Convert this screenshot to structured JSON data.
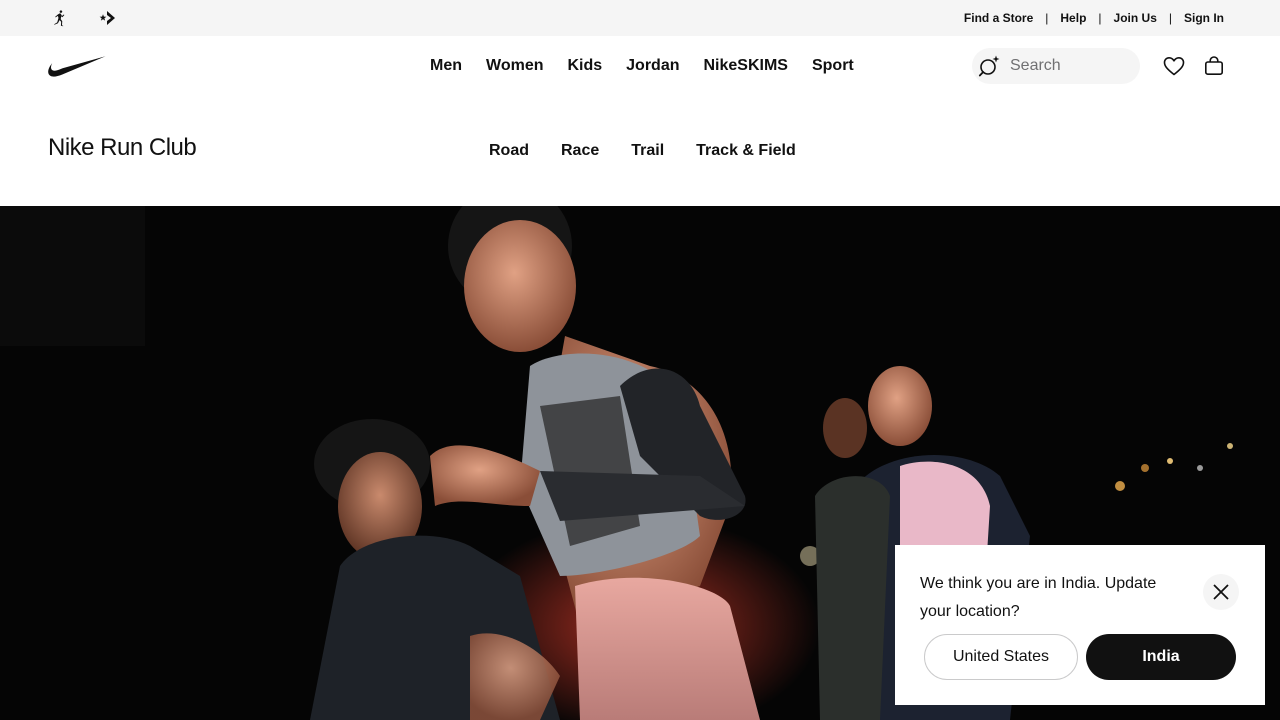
{
  "utility_bar": {
    "brand_icons": [
      "jordan-jumpman-icon",
      "converse-star-chevron-icon"
    ],
    "links": [
      "Find a Store",
      "Help",
      "Join Us",
      "Sign In"
    ],
    "separator": "|"
  },
  "main_nav": {
    "logo": "nike-swoosh-icon",
    "links": [
      "Men",
      "Women",
      "Kids",
      "Jordan",
      "NikeSKIMS",
      "Sport"
    ],
    "search": {
      "placeholder": "Search",
      "icon": "search-sparkle-icon"
    },
    "icons": [
      "heart-icon",
      "bag-icon"
    ]
  },
  "sub_nav": {
    "title": "Nike Run Club",
    "links": [
      "Road",
      "Race",
      "Trail",
      "Track & Field"
    ]
  },
  "hero": {
    "image": "Night run group photo of smiling runners in athletic wear"
  },
  "location_popup": {
    "message": "We think you are in India. Update your location?",
    "close_icon": "close-icon",
    "option_secondary": "United States",
    "option_primary": "India"
  },
  "colors": {
    "utility_bg": "#f5f5f5",
    "text": "#111111",
    "hero_bg": "#050505",
    "primary_button": "#111111",
    "placeholder": "#707072"
  }
}
